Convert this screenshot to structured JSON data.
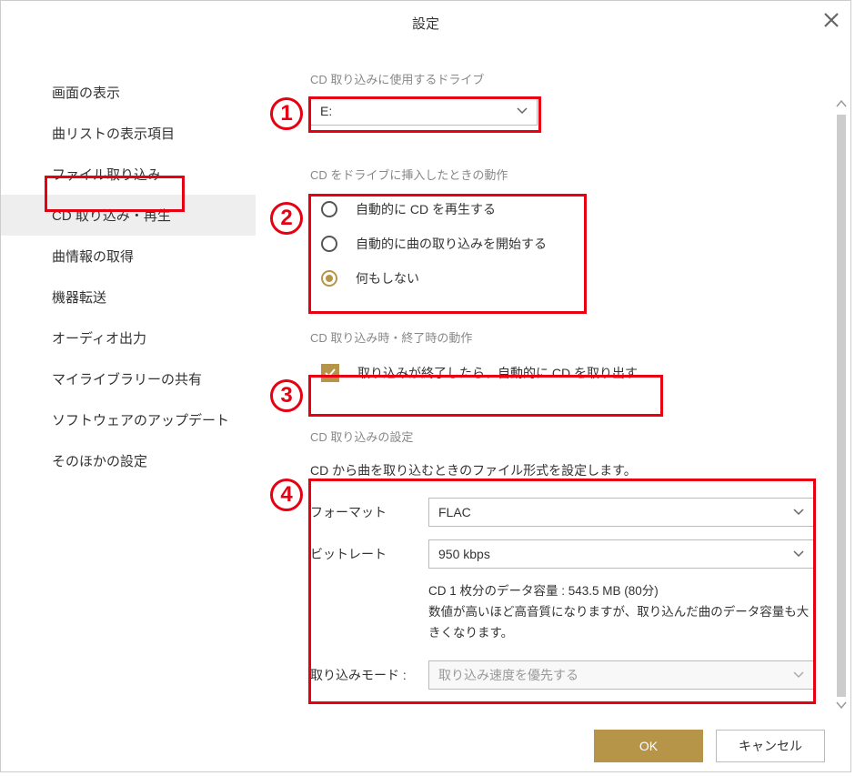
{
  "title": "設定",
  "sidebar": {
    "items": [
      {
        "label": "画面の表示"
      },
      {
        "label": "曲リストの表示項目"
      },
      {
        "label": "ファイル取り込み"
      },
      {
        "label": "CD 取り込み・再生"
      },
      {
        "label": "曲情報の取得"
      },
      {
        "label": "機器転送"
      },
      {
        "label": "オーディオ出力"
      },
      {
        "label": "マイライブラリーの共有"
      },
      {
        "label": "ソフトウェアのアップデート"
      },
      {
        "label": "そのほかの設定"
      }
    ]
  },
  "section1": {
    "label": "CD 取り込みに使用するドライブ",
    "drive": "E:"
  },
  "section2": {
    "label": "CD をドライブに挿入したときの動作",
    "options": [
      {
        "label": "自動的に CD を再生する"
      },
      {
        "label": "自動的に曲の取り込みを開始する"
      },
      {
        "label": "何もしない"
      }
    ]
  },
  "section3": {
    "label": "CD 取り込み時・終了時の動作",
    "checkbox_label": "取り込みが終了したら、自動的に CD を取り出す"
  },
  "section4": {
    "label": "CD 取り込みの設定",
    "desc": "CD から曲を取り込むときのファイル形式を設定します。",
    "format_label": "フォーマット",
    "format_value": "FLAC",
    "bitrate_label": "ビットレート",
    "bitrate_value": "950 kbps",
    "info1": "CD 1 枚分のデータ容量 : 543.5 MB (80分)",
    "info2": "数値が高いほど高音質になりますが、取り込んだ曲のデータ容量も大きくなります。",
    "mode_label": "取り込みモード :",
    "mode_value": "取り込み速度を優先する"
  },
  "footer": {
    "ok": "OK",
    "cancel": "キャンセル"
  },
  "markers": {
    "m1": "1",
    "m2": "2",
    "m3": "3",
    "m4": "4"
  }
}
